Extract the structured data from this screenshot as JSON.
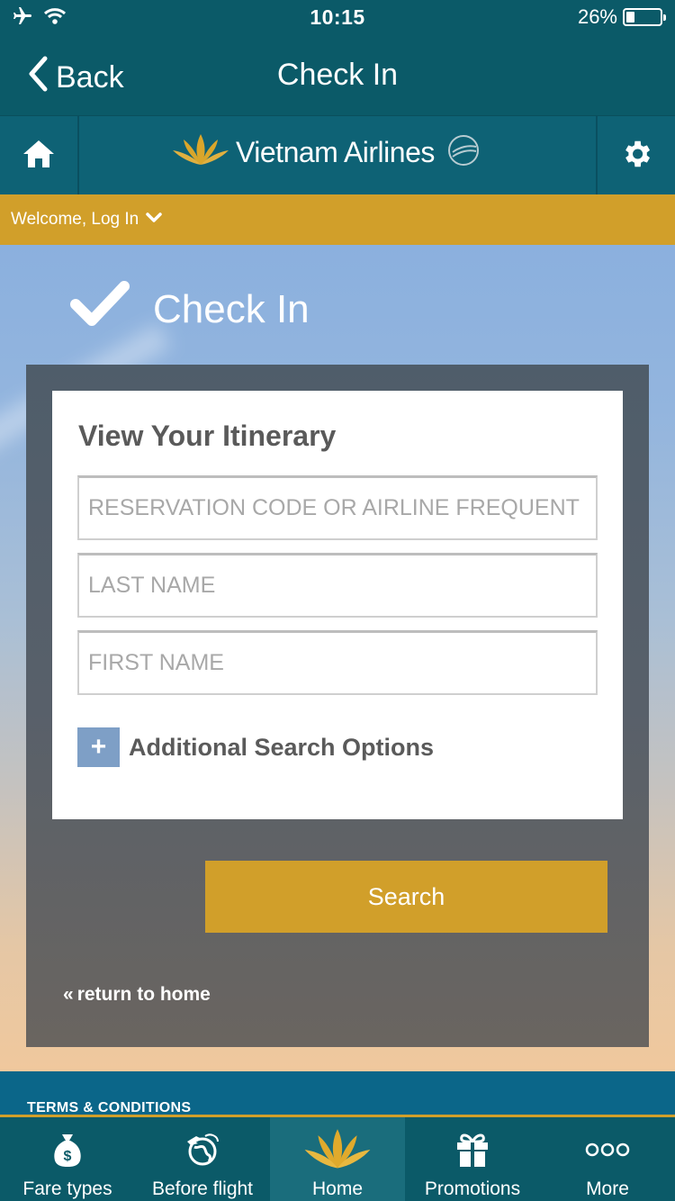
{
  "status_bar": {
    "time": "10:15",
    "battery": "26%",
    "battery_level": 0.26
  },
  "nav": {
    "back_label": "Back",
    "title": "Check In"
  },
  "brand": {
    "logo_text": "Vietnam Airlines"
  },
  "welcome": {
    "label": "Welcome, Log In"
  },
  "page": {
    "heading": "Check In"
  },
  "form": {
    "title": "View Your Itinerary",
    "reservation_placeholder": "RESERVATION CODE OR AIRLINE FREQUENT FLYER NUMBER",
    "last_name_placeholder": "LAST NAME",
    "first_name_placeholder": "FIRST NAME",
    "additional_label": "Additional Search Options",
    "plus_symbol": "+"
  },
  "actions": {
    "search_label": "Search",
    "return_label": "return to home",
    "return_arrow": "«"
  },
  "footer": {
    "terms_label": "TERMS & CONDITIONS"
  },
  "tabs": [
    {
      "label": "Fare types",
      "icon": "money-bag-icon"
    },
    {
      "label": "Before flight",
      "icon": "globe-plane-icon"
    },
    {
      "label": "Home",
      "icon": "lotus-icon",
      "active": true
    },
    {
      "label": "Promotions",
      "icon": "gift-icon"
    },
    {
      "label": "More",
      "icon": "more-dots-icon"
    }
  ],
  "colors": {
    "teal": "#0b5a68",
    "gold": "#d19f2a",
    "accent_blue": "#7e9fc6"
  }
}
